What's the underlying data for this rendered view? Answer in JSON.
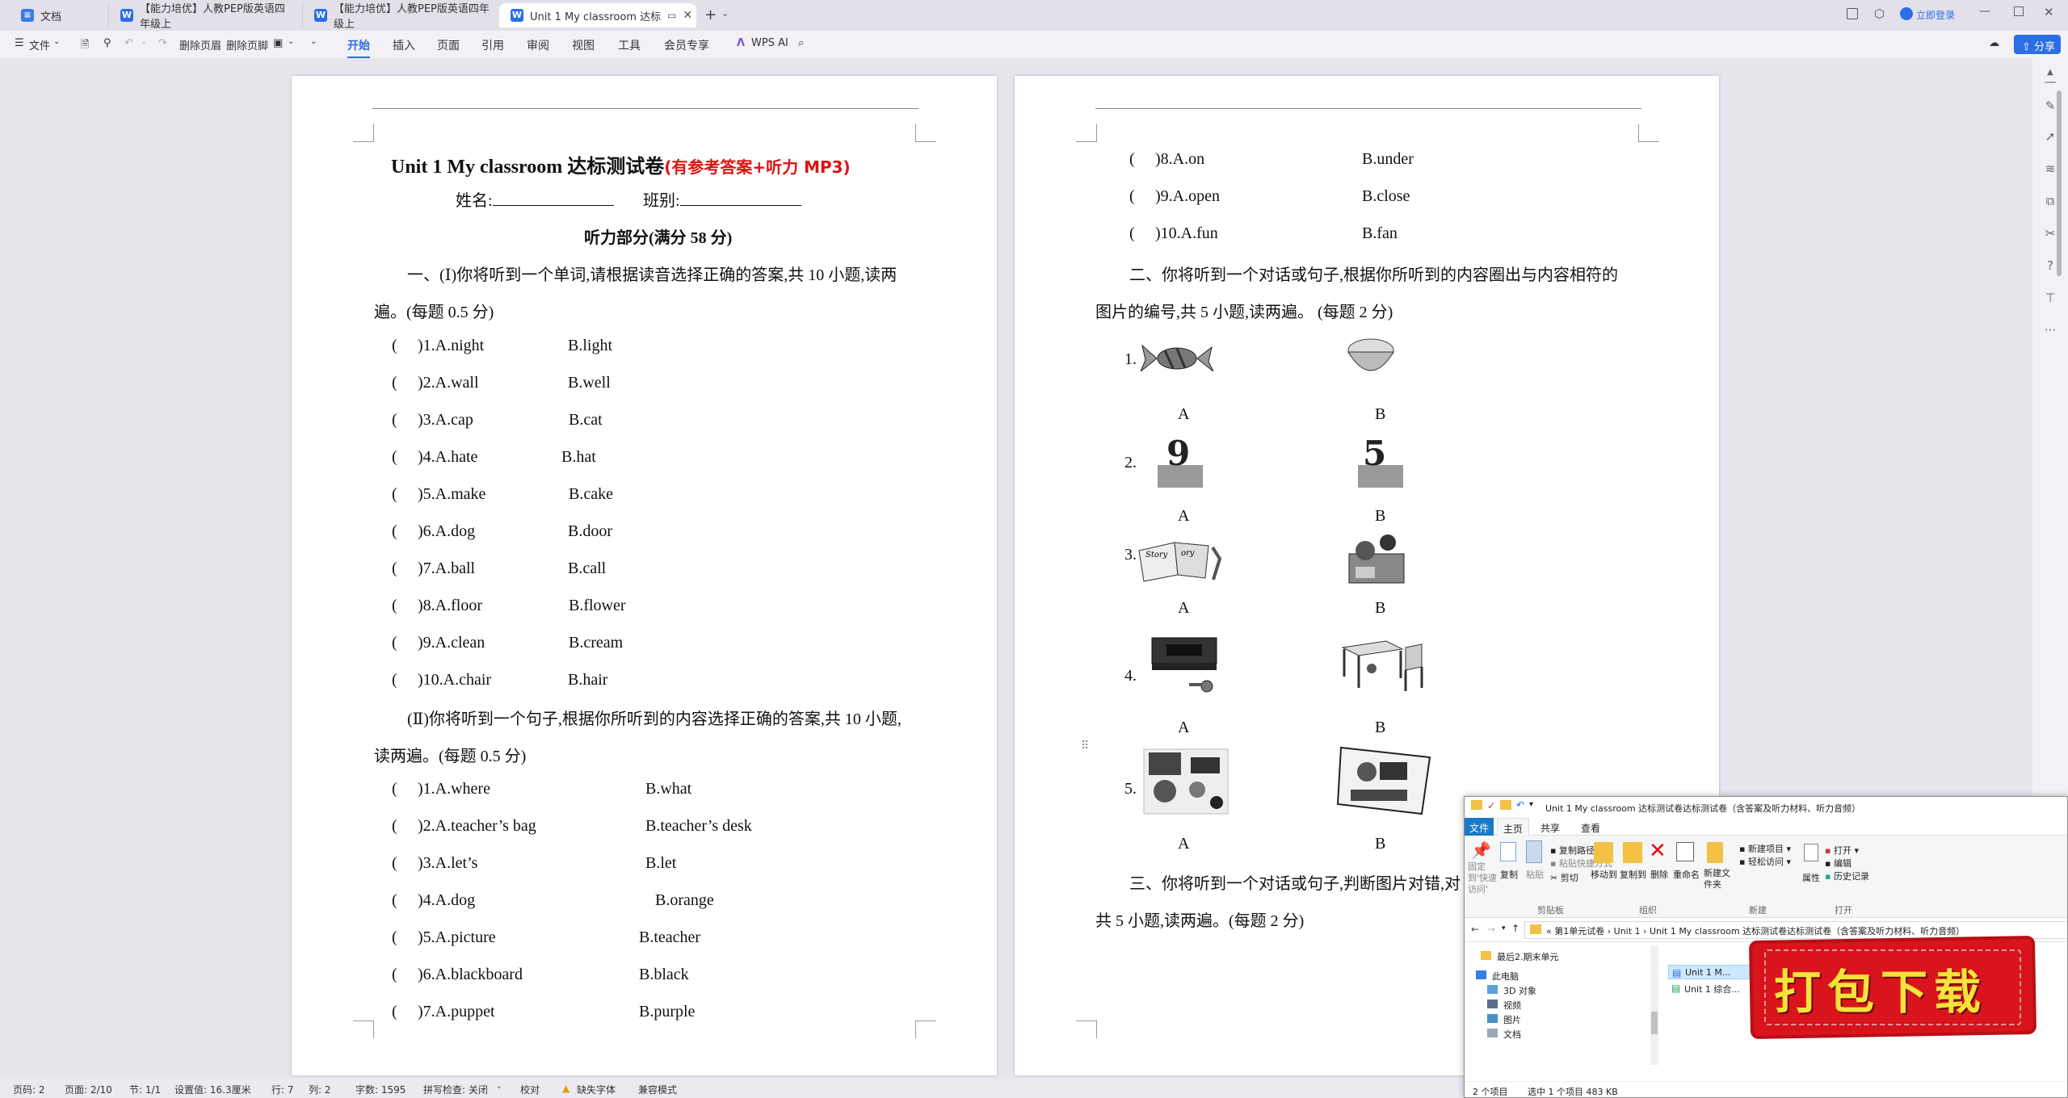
{
  "tabs": [
    {
      "label": "文档",
      "active": false
    },
    {
      "label": "【能力培优】人教PEP版英语四年级上",
      "active": false
    },
    {
      "label": "【能力培优】人教PEP版英语四年级上",
      "active": false
    },
    {
      "label": "Unit 1   My classroom 达标",
      "active": true
    }
  ],
  "titlebar": {
    "login": "立即登录"
  },
  "toolbar": {
    "file": "文件",
    "delete_header": "删除页眉",
    "delete_footer": "删除页脚",
    "menus": [
      "开始",
      "插入",
      "页面",
      "引用",
      "审阅",
      "视图",
      "工具",
      "会员专享"
    ],
    "active_menu": "开始",
    "wps_ai": "WPS AI",
    "share": "分享"
  },
  "page1": {
    "title_main": "Unit 1    My classroom  达标测试卷",
    "title_red": "(有参考答案+听力 MP3)",
    "name_label": "姓名:",
    "class_label": "班别:",
    "section_title": "听力部分(满分 58 分)",
    "part1_intro_a": "一、(Ⅰ)你将听到一个单词,请根据读音选择正确的答案,共 10 小题,读两",
    "part1_intro_b": "遍。(每题 0.5 分)",
    "part1_items": [
      {
        "q": ")1.A.night",
        "b": "B.light"
      },
      {
        "q": ")2.A.wall",
        "b": "B.well"
      },
      {
        "q": ")3.A.cap",
        "b": "B.cat"
      },
      {
        "q": ")4.A.hate",
        "b": "B.hat"
      },
      {
        "q": ")5.A.make",
        "b": "B.cake"
      },
      {
        "q": ")6.A.dog",
        "b": "B.door"
      },
      {
        "q": ")7.A.ball",
        "b": "B.call"
      },
      {
        "q": ")8.A.floor",
        "b": "B.flower"
      },
      {
        "q": ")9.A.clean",
        "b": "B.cream"
      },
      {
        "q": ")10.A.chair",
        "b": "B.hair"
      }
    ],
    "part2_intro_a": "(Ⅱ)你将听到一个句子,根据你所听到的内容选择正确的答案,共 10 小题,",
    "part2_intro_b": "读两遍。(每题 0.5 分)",
    "part2_items": [
      {
        "q": ")1.A.where",
        "b": "B.what"
      },
      {
        "q": ")2.A.teacher’s bag",
        "b": "B.teacher’s desk"
      },
      {
        "q": ")3.A.let’s",
        "b": "B.let"
      },
      {
        "q": ")4.A.dog",
        "b": "B.orange"
      },
      {
        "q": ")5.A.picture",
        "b": "B.teacher"
      },
      {
        "q": ")6.A.blackboard",
        "b": "B.black"
      },
      {
        "q": ")7.A.puppet",
        "b": "B.purple"
      }
    ]
  },
  "page2": {
    "items_top": [
      {
        "q": ")8.A.on",
        "b": "B.under"
      },
      {
        "q": ")9.A.open",
        "b": "B.close"
      },
      {
        "q": ")10.A.fun",
        "b": "B.fan"
      }
    ],
    "part2_a": "二、你将听到一个对话或句子,根据你所听到的内容圈出与内容相符的",
    "part2_b": "图片的编号,共 5 小题,读两遍。 (每题 2 分)",
    "pic_rows": [
      {
        "num": "1.",
        "a": "A",
        "b": "B"
      },
      {
        "num": "2.",
        "a": "A",
        "b": "B"
      },
      {
        "num": "3.",
        "a": "A",
        "b": "B"
      },
      {
        "num": "4.",
        "a": "A",
        "b": "B"
      },
      {
        "num": "5.",
        "a": "A",
        "b": "B"
      }
    ],
    "part3_a": "三、你将听到一个对话或句子,判断图片对错,对",
    "part3_b": "共 5 小题,读两遍。(每题 2 分)"
  },
  "explorer": {
    "title": "Unit 1    My classroom 达标测试卷达标测试卷（含答案及听力材料、听力音频）",
    "ribbon_tabs": [
      "文件",
      "主页",
      "共享",
      "查看"
    ],
    "groups": {
      "clipboard": "剪贴板",
      "organize": "组织",
      "new": "新建",
      "open": "打开"
    },
    "buttons": {
      "pin": "固定到'快速访问'",
      "copy": "复制",
      "paste": "粘贴",
      "copy_path": "复制路径",
      "paste_shortcut": "粘贴快捷方式",
      "cut": "剪切",
      "move_to": "移动到",
      "copy_to": "复制到",
      "delete": "删除",
      "rename": "重命名",
      "new_item": "新建项目",
      "easy_access": "轻松访问",
      "new_folder": "新建文件夹",
      "properties": "属性",
      "open": "打开",
      "edit": "编辑",
      "history": "历史记录"
    },
    "path": [
      "«",
      "第1单元试卷",
      "›",
      "Unit 1",
      "›",
      "Unit 1    My classroom 达标测试卷达标测试卷（含答案及听力材料、听力音频）"
    ],
    "nav": [
      {
        "label": "最后2.期末单元",
        "icon": "folder-icon"
      },
      {
        "label": "此电脑",
        "icon": "computer-icon"
      },
      {
        "label": "3D 对象",
        "icon": "cube-icon"
      },
      {
        "label": "视频",
        "icon": "video-icon"
      },
      {
        "label": "图片",
        "icon": "picture-icon"
      },
      {
        "label": "文档",
        "icon": "document-icon"
      }
    ],
    "files": [
      "Unit 1    M...",
      "Unit 1 综合..."
    ],
    "status_count": "2 个项目",
    "status_selected": "选中 1 个项目  483 KB"
  },
  "watermark": {
    "text": "打包下载"
  },
  "statusbar": {
    "page": "页码: 2",
    "pages": "页面: 2/10",
    "section": "节: 1/1",
    "setting": "设置值: 16.3厘米",
    "row": "行: 7",
    "col": "列: 2",
    "words": "字数: 1595",
    "spell": "拼写检查: 关闭",
    "proof": "校对",
    "missing_font": "缺失字体",
    "compat": "兼容模式"
  },
  "colors": {
    "accent": "#2b6ee6",
    "title_red": "#e01010",
    "stamp_red": "#d9141c",
    "stamp_text": "#f5e23a"
  }
}
